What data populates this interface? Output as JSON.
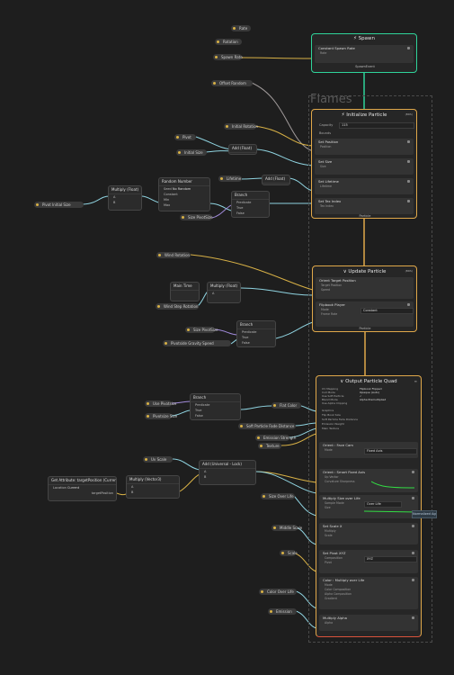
{
  "system_title": "Flames",
  "properties": {
    "rate": "Rate",
    "rotation": "Rotation",
    "spawn_rate": "Spawn Rate",
    "offset_random": "Offset Random",
    "initial_rotation": "Initial Rotation",
    "pivot": "Pivot",
    "initial_size": "Initial Size",
    "lifetime": "Lifetime",
    "pivot_initial_size": "Pivot Initial Size",
    "size_pivotsize": "Size PivotSize",
    "wind_rotation": "Wind Rotation",
    "wind_step_rotation": "Wind Step Rotation",
    "size_pivotsize_2": "Size PivotSize",
    "pivot_from_gravity": "Pivotside Gravity Speed",
    "use_pivotsize": "Use Pivotsize",
    "pivotsize_size": "Pivotsize Size",
    "flat_color": "Flat Color",
    "soft_particle_fade": "Soft Particle Fade Distance",
    "emission_strength": "Emission Strength",
    "texture": "Texture",
    "color_over_life": "Size Over Life",
    "middle_scale": "Middle Scale",
    "blend_scale": "Scale",
    "color_over_life2": "Color Over Life",
    "emission": "Emission",
    "uv_scale": "Uv Scale",
    "flame_desc_red": "Set Attribute: TargetPosition (Current)"
  },
  "spawn": {
    "title": "Spawn",
    "flow_in": [
      "Start",
      "Stop"
    ],
    "block": "Constant Spawn Rate",
    "block_row": "Rate",
    "flow_out": "SpawnEvent"
  },
  "initialize": {
    "title": "Initialize Particle",
    "badge": "(BRS)",
    "capacity_label": "Capacity",
    "capacity": "115",
    "bounds_label": "Bounds",
    "blocks": [
      {
        "title": "Set Position",
        "row": "Position"
      },
      {
        "title": "Set Size",
        "row": "Size"
      },
      {
        "title": "Set Lifetime",
        "row": "Lifetime"
      },
      {
        "title": "Set Tex Index",
        "row": "Tex Index"
      }
    ],
    "flow_out": "Particle"
  },
  "update": {
    "title": "Update Particle",
    "badge": "(BRS)",
    "blocks": [
      {
        "title": "Orient Target Position",
        "rows": [
          "Target Position",
          "Speed"
        ]
      },
      {
        "title": "Flipbook Player",
        "rows": [
          "Mode",
          "Frame Rate"
        ],
        "value": "Constant"
      }
    ],
    "flow_out": "Particle"
  },
  "output": {
    "title": "Output Particle Quad",
    "settings": [
      {
        "k": "UV Mapping",
        "v": "Flipbook Flipped"
      },
      {
        "k": "Cull Mode",
        "v": "Opaque (Auto)"
      },
      {
        "k": "Use Soft Particle",
        "v": "✓"
      },
      {
        "k": "Blend Mode",
        "v": "Alpha Premultiplied"
      },
      {
        "k": "Use Alpha Clipping",
        "v": ""
      }
    ],
    "rows": [
      "Graphics",
      "Flip Book Size",
      "Soft Particle Fade Distance",
      "Emission Weight",
      "Main Texture"
    ],
    "blocks": [
      {
        "title": "Orient : Face Cam",
        "row": "Mode",
        "value": "Fixed Axis"
      },
      {
        "title": "Orient : Smart Fixed Axis",
        "rows": [
          "Up Vector",
          "Curvature Sharpness"
        ]
      },
      {
        "title": "Multiply Size over Life",
        "rows": [
          "Sample Mode",
          "Size"
        ],
        "value": "Over Life"
      },
      {
        "title": "Set Scale X",
        "rows": [
          "Multiply",
          "Scale"
        ]
      },
      {
        "title": "Set Pivot XYZ",
        "rows": [
          "Composition",
          "Pivot"
        ],
        "value": "XYZ"
      },
      {
        "title": "Color : Multiply over Life",
        "rows": [
          "Mode",
          "Color Composition",
          "Alpha Composition",
          "Gradient"
        ]
      },
      {
        "title": "Multiply Alpha",
        "rows": [
          "Alpha"
        ]
      }
    ],
    "tooltip": "Normalized Age"
  },
  "operators": {
    "multiply_float": "Multiply (Float)",
    "random_number": "Random Number",
    "add_float": "Add (Float)",
    "branch": "Branch",
    "add_float_2": "Add (Float)",
    "multiply_float_2": "Multiply (Float)",
    "time_frac": "Main Time",
    "branch_2": "Branch",
    "branch_3": "Branch",
    "add_universal": "Add (Universal - Lock)",
    "multiply_vector": "Multiply (Vector3)",
    "get_attr_current": "Current",
    "get_attr_title": "Get Attribute: targetPosition (Current)",
    "location_label": "Location",
    "location_value": "Current",
    "target_pos": "targetPosition",
    "seed_label": "Seed",
    "constant_label": "Constant",
    "no_random": "No Random",
    "predicate": "Predicate",
    "true_label": "True",
    "false_label": "False",
    "branch_values": [
      "1",
      "0",
      "3"
    ]
  },
  "colors": {
    "background": "#1e1e1e",
    "spawn_border": "#2fd39a",
    "context_border": "#e0a84a",
    "output_border": "#e0a84a",
    "output_bottom": "#d9533b",
    "float_edge": "#8fd3e0",
    "vector_edge": "#d8b146",
    "bool_edge": "#a08ad9",
    "flow_edge": "#e0a84a"
  }
}
